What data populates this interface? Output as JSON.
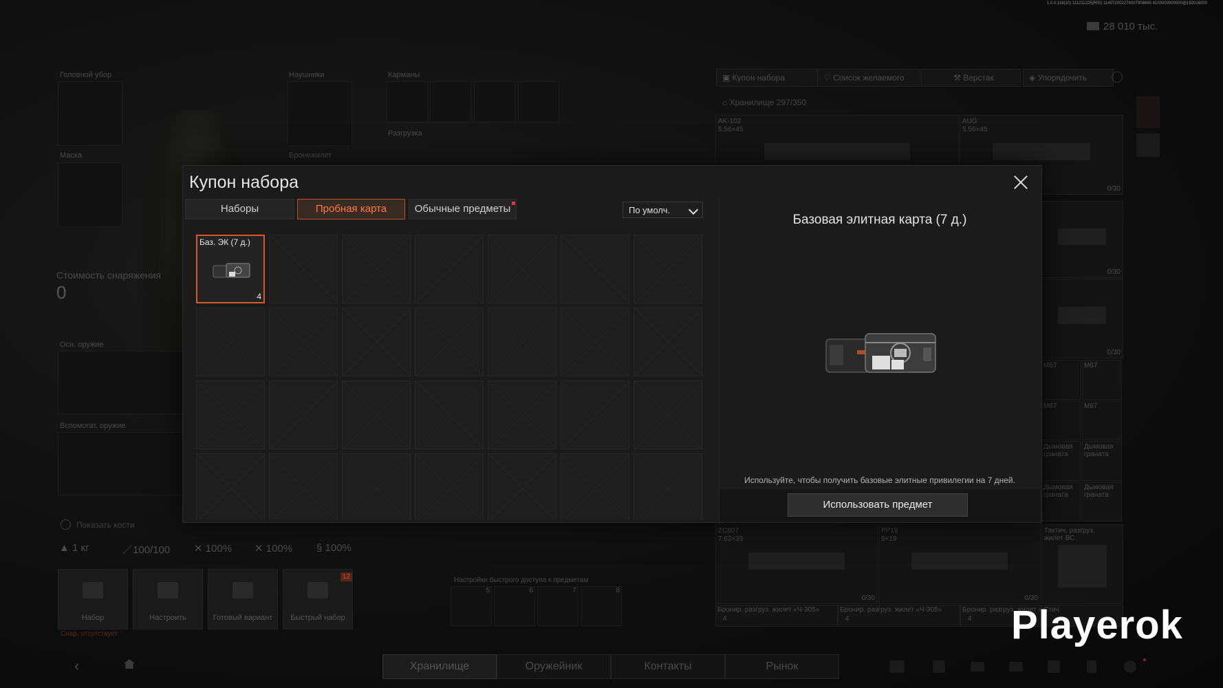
{
  "top": {
    "build_string": "1.0.0.116(10) 111211225(R00) 114072002274007906665 4100000000000@192016000",
    "currency": "28 010 тыс."
  },
  "equipment": {
    "headwear_label": "Головной убор",
    "headphones_label": "Наушники",
    "pockets_label": "Карманы",
    "mask_label": "Маска",
    "armor_label": "Бронежилет",
    "rig_label": "Разгрузка",
    "gear_value_label": "Стоимость снаряжения",
    "gear_value": "0",
    "primary_label": "Осн. оружие",
    "secondary_label": "Вспомогат. оружие",
    "show_bones": "Показать кости",
    "stats": {
      "weight": "1 кг",
      "durability": "100/100",
      "s2": "100%",
      "s3": "100%",
      "s4": "100%"
    },
    "quick_access_label": "Настройки быстрого доступа к предметам",
    "quick_slots": [
      "5",
      "6",
      "7",
      "8"
    ],
    "actions": [
      {
        "label": "Набор"
      },
      {
        "label": "Настроить"
      },
      {
        "label": "Готовый вариант"
      },
      {
        "label": "Быстрый набор",
        "badge": "12"
      }
    ],
    "missing_note": "Снар. отсутствует"
  },
  "storage": {
    "toolbar": {
      "coupon": "Купон набора",
      "wishlist": "Список желаемого",
      "workbench": "Верстак",
      "sort": "Упорядочить"
    },
    "capacity": "Хранилище 297/350",
    "weapons": [
      {
        "name": "AK-102",
        "cal": "5.56×45"
      },
      {
        "name": "AUG",
        "cal": "5.56×45"
      }
    ],
    "slot_counts": [
      "0/30",
      "0/30",
      "0/30"
    ],
    "grenades": [
      "M67",
      "M67",
      "M67",
      "M67",
      "Дымовая граната",
      "Дымовая граната",
      "Дымовая граната",
      "Дымовая граната"
    ],
    "bottom_weapons": [
      {
        "name": "ZC807",
        "cal": "7.62×39",
        "count": "0/30"
      },
      {
        "name": "PP19",
        "cal": "9×19",
        "count": "0/30"
      },
      {
        "name": "Тактич. разгруз. жилет ВС"
      }
    ],
    "vests": [
      "Бронир. разгруз. жилет «Ч-305»",
      "Бронир. разгруз. жилет «Ч-305»",
      "Бронир. разгруз. жилет «Ч-305»",
      "Стич"
    ],
    "vest_counts": [
      "4",
      "4",
      "4"
    ]
  },
  "nav": {
    "tabs": [
      "Хранилище",
      "Оружейник",
      "Контакты",
      "Рынок"
    ]
  },
  "modal": {
    "title": "Купон набора",
    "tabs": [
      "Наборы",
      "Пробная карта",
      "Обычные предметы"
    ],
    "active_tab": 1,
    "sort": "По умолч.",
    "item": {
      "name": "Баз. ЭК (7 д.)",
      "count": "4"
    },
    "detail": {
      "title": "Базовая элитная карта (7 д.)",
      "description": "Используйте, чтобы получить базовые элитные привилегии на 7 дней.",
      "use_button": "Использовать предмет"
    }
  },
  "watermark": "Playerok",
  "colors": {
    "accent": "#d65a2a",
    "badge": "#e03a2a"
  }
}
